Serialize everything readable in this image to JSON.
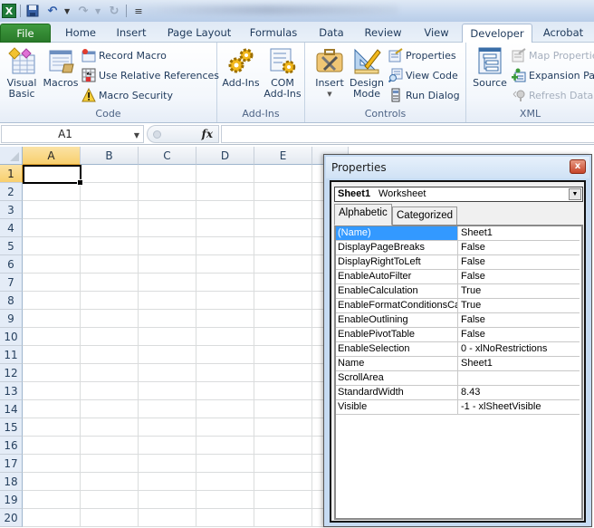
{
  "app": {
    "quick_access": [
      {
        "name": "excel-logo-icon",
        "glyph": "X"
      },
      {
        "name": "save-icon",
        "glyph": "💾"
      },
      {
        "name": "undo-icon",
        "glyph": "↶"
      },
      {
        "name": "redo-icon",
        "glyph": "↷"
      },
      {
        "name": "refresh-icon",
        "glyph": "↻"
      },
      {
        "name": "customize-qat-icon",
        "glyph": "≡"
      }
    ]
  },
  "tabs": [
    {
      "label": "File"
    },
    {
      "label": "Home"
    },
    {
      "label": "Insert"
    },
    {
      "label": "Page Layout"
    },
    {
      "label": "Formulas"
    },
    {
      "label": "Data"
    },
    {
      "label": "Review"
    },
    {
      "label": "View"
    },
    {
      "label": "Developer",
      "active": true
    },
    {
      "label": "Acrobat"
    }
  ],
  "ribbon": {
    "code": {
      "label": "Code",
      "visual_basic": "Visual Basic",
      "visual_basic_l1": "Visual",
      "visual_basic_l2": "Basic",
      "macros": "Macros",
      "record_macro": "Record Macro",
      "use_relative": "Use Relative References",
      "macro_security": "Macro Security"
    },
    "addins": {
      "label": "Add-Ins",
      "add_ins": "Add-Ins",
      "com_l1": "COM",
      "com_l2": "Add-Ins"
    },
    "controls": {
      "label": "Controls",
      "insert": "Insert",
      "design_l1": "Design",
      "design_l2": "Mode",
      "properties": "Properties",
      "view_code": "View Code",
      "run_dialog": "Run Dialog"
    },
    "xml": {
      "label": "XML",
      "source": "Source",
      "map_properties": "Map Propertie",
      "expansion_packs": "Expansion Pac",
      "refresh_data": "Refresh Data"
    }
  },
  "formula_bar": {
    "name_box": "A1",
    "fx": "fx",
    "formula": ""
  },
  "sheet": {
    "columns": [
      "A",
      "B",
      "C",
      "D",
      "E"
    ],
    "rows": [
      "1",
      "2",
      "3",
      "4",
      "5",
      "6",
      "7",
      "8",
      "9",
      "10",
      "11",
      "12",
      "13",
      "14",
      "15",
      "16",
      "17",
      "18",
      "19",
      "20"
    ],
    "active_cell": "A1"
  },
  "properties_window": {
    "title": "Properties",
    "close": "x",
    "object_name": "Sheet1",
    "object_type": "Worksheet",
    "tabs": [
      "Alphabetic",
      "Categorized"
    ],
    "active_tab": "Alphabetic",
    "rows": [
      {
        "key": "(Name)",
        "value": "Sheet1",
        "selected": true
      },
      {
        "key": "DisplayPageBreaks",
        "value": "False"
      },
      {
        "key": "DisplayRightToLeft",
        "value": "False"
      },
      {
        "key": "EnableAutoFilter",
        "value": "False"
      },
      {
        "key": "EnableCalculation",
        "value": "True"
      },
      {
        "key": "EnableFormatConditionsCalculation",
        "value": "True"
      },
      {
        "key": "EnableOutlining",
        "value": "False"
      },
      {
        "key": "EnablePivotTable",
        "value": "False"
      },
      {
        "key": "EnableSelection",
        "value": "0 - xlNoRestrictions"
      },
      {
        "key": "Name",
        "value": "Sheet1"
      },
      {
        "key": "ScrollArea",
        "value": ""
      },
      {
        "key": "StandardWidth",
        "value": "8.43"
      },
      {
        "key": "Visible",
        "value": "-1 - xlSheetVisible"
      }
    ]
  }
}
